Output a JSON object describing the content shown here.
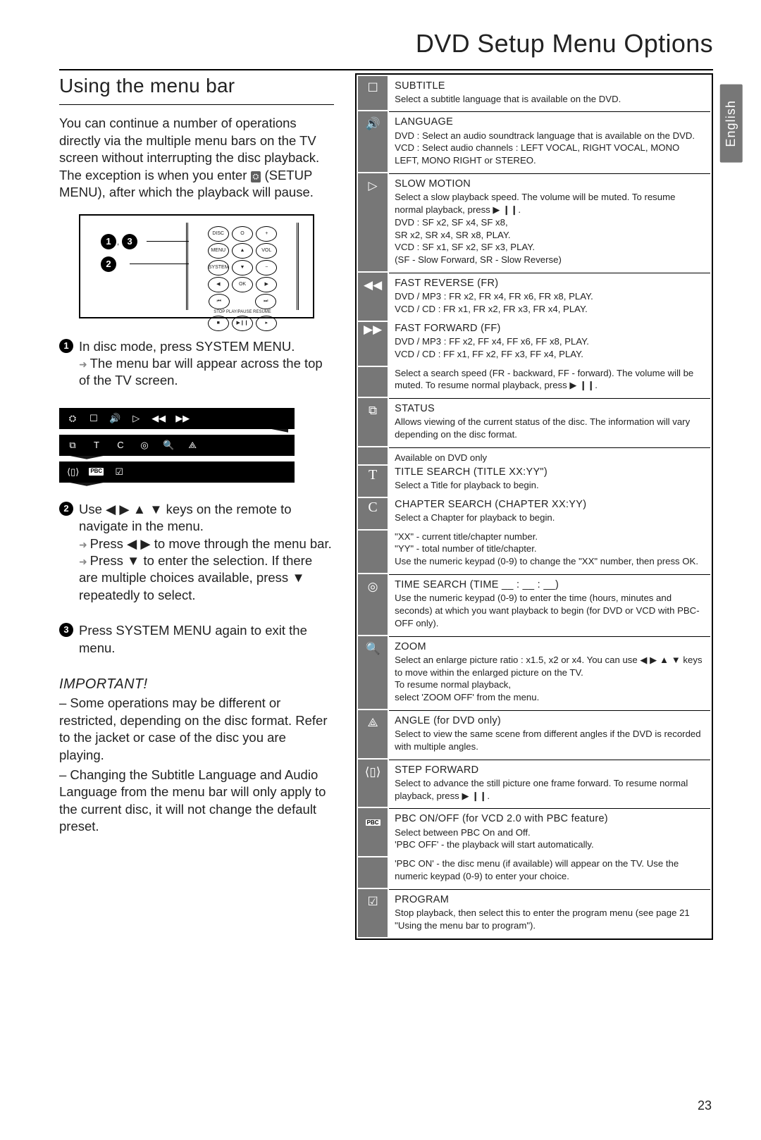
{
  "page_title": "DVD Setup Menu Options",
  "language_tab": "English",
  "page_number": "23",
  "left": {
    "heading": "Using the menu bar",
    "intro_1": "You can continue a number of operations directly via the multiple menu bars on the TV screen without interrupting the disc playback. The exception is when you enter ",
    "intro_2": "(SETUP MENU), after which the playback will pause.",
    "remote_callouts": [
      "1",
      "3",
      "2"
    ],
    "remote_buttons_row1": [
      "DISC",
      "O",
      "+"
    ],
    "remote_buttons_row2": [
      "MENU",
      "",
      "VOL"
    ],
    "remote_buttons_row3": [
      "SYSTEM",
      "",
      "−"
    ],
    "remote_arrows": [
      "◀",
      "OK",
      "▶"
    ],
    "remote_bottom": [
      "STOP",
      "PLAY/PAUSE",
      "RESUME"
    ],
    "step1": "In disc mode, press SYSTEM MENU.",
    "step1_sub": "The menu bar will appear across the top of the TV screen.",
    "step2_a": "Use ◀ ▶ ▲ ▼ keys on the remote to navigate in the menu.",
    "step2_b": "Press ◀ ▶ to move through the menu bar.",
    "step2_c": "Press ▼ to enter the selection. If there are multiple choices available, press ▼ repeatedly to select.",
    "step3": "Press SYSTEM MENU again to exit the menu.",
    "important_hd": "IMPORTANT!",
    "important_1": "– Some operations may be different or restricted, depending on the disc format. Refer to the jacket or case of the disc you are playing.",
    "important_2": "– Changing the Subtitle Language and Audio Language from the menu bar will only apply to the current disc, it will not change the default preset."
  },
  "menubar_icons": {
    "row1": [
      "⛭",
      "☐",
      "🔊",
      "▷",
      "◀◀",
      "▶▶"
    ],
    "row2": [
      "⧉",
      "T",
      "C",
      "◎",
      "🔍",
      "⟁"
    ],
    "row3": [
      "⟨▯⟩",
      "PBC",
      "☑"
    ]
  },
  "table": [
    {
      "icon": "☐",
      "title": "SUBTITLE",
      "body": "Select a subtitle language that is available on the DVD."
    },
    {
      "icon": "🔊",
      "title": "LANGUAGE",
      "body": "DVD : Select an audio soundtrack language that is available on the DVD.\nVCD : Select audio channels : LEFT VOCAL, RIGHT VOCAL, MONO LEFT, MONO RIGHT or STEREO."
    },
    {
      "icon": "▷",
      "title": "SLOW MOTION",
      "body": "Select a slow playback speed. The volume will be muted. To resume normal playback, press ▶ ❙❙.\nDVD : SF x2, SF x4, SF x8,\n        SR x2, SR x4, SR x8, PLAY.\nVCD : SF x1, SF x2, SF x3, PLAY.\n        (SF - Slow Forward, SR - Slow Reverse)"
    },
    {
      "icon": "◀◀",
      "title": "FAST REVERSE (FR)",
      "body": "DVD / MP3 : FR x2, FR x4, FR x6, FR x8, PLAY.\nVCD / CD : FR x1, FR x2, FR x3, FR x4, PLAY."
    },
    {
      "icon": "▶▶",
      "title": "FAST FORWARD (FF)",
      "body": "DVD / MP3 : FF x2, FF x4, FF x6, FF x8, PLAY.\nVCD / CD : FF x1, FF x2, FF x3, FF x4, PLAY.",
      "noborder": true
    },
    {
      "icon": "",
      "title": "",
      "body": "Select a search speed (FR - backward, FF - forward). The volume will be muted. To resume normal playback, press ▶ ❙❙.",
      "noborder": true,
      "joinicon": true
    },
    {
      "icon": "⧉",
      "title": "STATUS",
      "body": "Allows viewing of the current status of the disc. The information will vary depending on the disc format."
    },
    {
      "icon": "",
      "title": "",
      "body": "Available on DVD only",
      "noborder": false,
      "joinicon": true,
      "smalltop": true
    },
    {
      "icon": "T",
      "title": "TITLE SEARCH (TITLE XX:YY\")",
      "body": "Select a Title for playback to begin.",
      "letter": true,
      "noborder": true
    },
    {
      "icon": "C",
      "title": "CHAPTER SEARCH (CHAPTER XX:YY)",
      "body": "Select a Chapter for playback to begin.",
      "letter": true,
      "noborder": true
    },
    {
      "icon": "",
      "title": "",
      "body": "\"XX\" - current title/chapter number.\n\"YY\" - total number of title/chapter.\nUse the numeric keypad (0-9) to change the \"XX\" number, then press OK.",
      "noborder": true,
      "joinicon": true
    },
    {
      "icon": "◎",
      "title": "TIME SEARCH (TIME __ : __ : __)",
      "body": "Use the numeric keypad (0-9) to enter the time (hours, minutes and seconds) at which you want playback to begin (for DVD or VCD with PBC-OFF only)."
    },
    {
      "icon": "🔍",
      "title": "ZOOM",
      "body": "Select an enlarge picture ratio : x1.5, x2 or x4. You can use ◀ ▶ ▲ ▼ keys to move within the enlarged picture on the TV.\nTo resume normal playback,\nselect 'ZOOM OFF' from the menu."
    },
    {
      "icon": "⟁",
      "title": "ANGLE (for DVD only)",
      "body": "Select to view the same scene from different angles if the DVD is recorded with multiple angles."
    },
    {
      "icon": "⟨▯⟩",
      "title": "STEP FORWARD",
      "body": "Select to advance the still picture one frame forward. To resume normal playback, press ▶ ❙❙."
    },
    {
      "icon": "PBC",
      "title": "PBC ON/OFF (for VCD 2.0 with PBC feature)",
      "body": "Select between PBC On and Off.\n'PBC OFF' - the playback will start automatically.",
      "pbc": true
    },
    {
      "icon": "",
      "title": "",
      "body": "'PBC ON' - the disc menu (if available) will appear on the TV. Use the numeric keypad (0-9) to enter your choice.",
      "noborder": true,
      "joinicon": true
    },
    {
      "icon": "☑",
      "title": "PROGRAM",
      "body": "Stop playback, then select this to enter the program menu (see page 21 \"Using the menu bar to program\")."
    }
  ]
}
